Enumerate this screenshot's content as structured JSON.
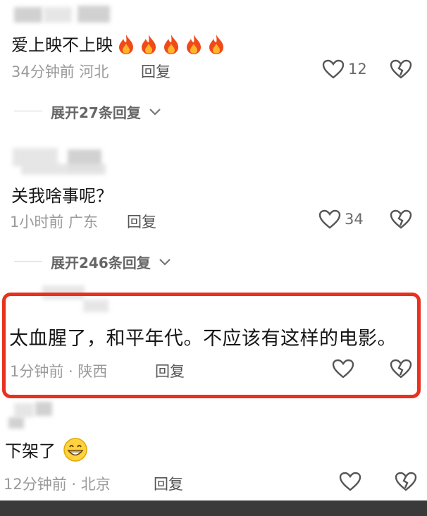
{
  "comments": [
    {
      "text": "爱上映不上映",
      "emoji": "🔥🔥🔥🔥🔥",
      "time_location": "34分钟前 河北",
      "reply_label": "回复",
      "likes": "12",
      "expand_label": "展开27条回复"
    },
    {
      "text": "关我啥事呢？",
      "time_location": "1小时前 广东",
      "reply_label": "回复",
      "likes": "34",
      "expand_label": "展开246条回复"
    },
    {
      "text": "太血腥了，和平年代。不应该有这样的电影。",
      "time_location": "1分钟前 · 陕西",
      "reply_label": "回复"
    },
    {
      "text": "下架了",
      "time_location": "12分钟前 · 北京",
      "reply_label": "回复"
    }
  ],
  "colors": {
    "highlight": "#e8311f"
  },
  "icons": [
    "fire-emoji",
    "heart-icon",
    "broken-heart-icon",
    "grin-emoji-icon",
    "chevron-down-icon"
  ]
}
